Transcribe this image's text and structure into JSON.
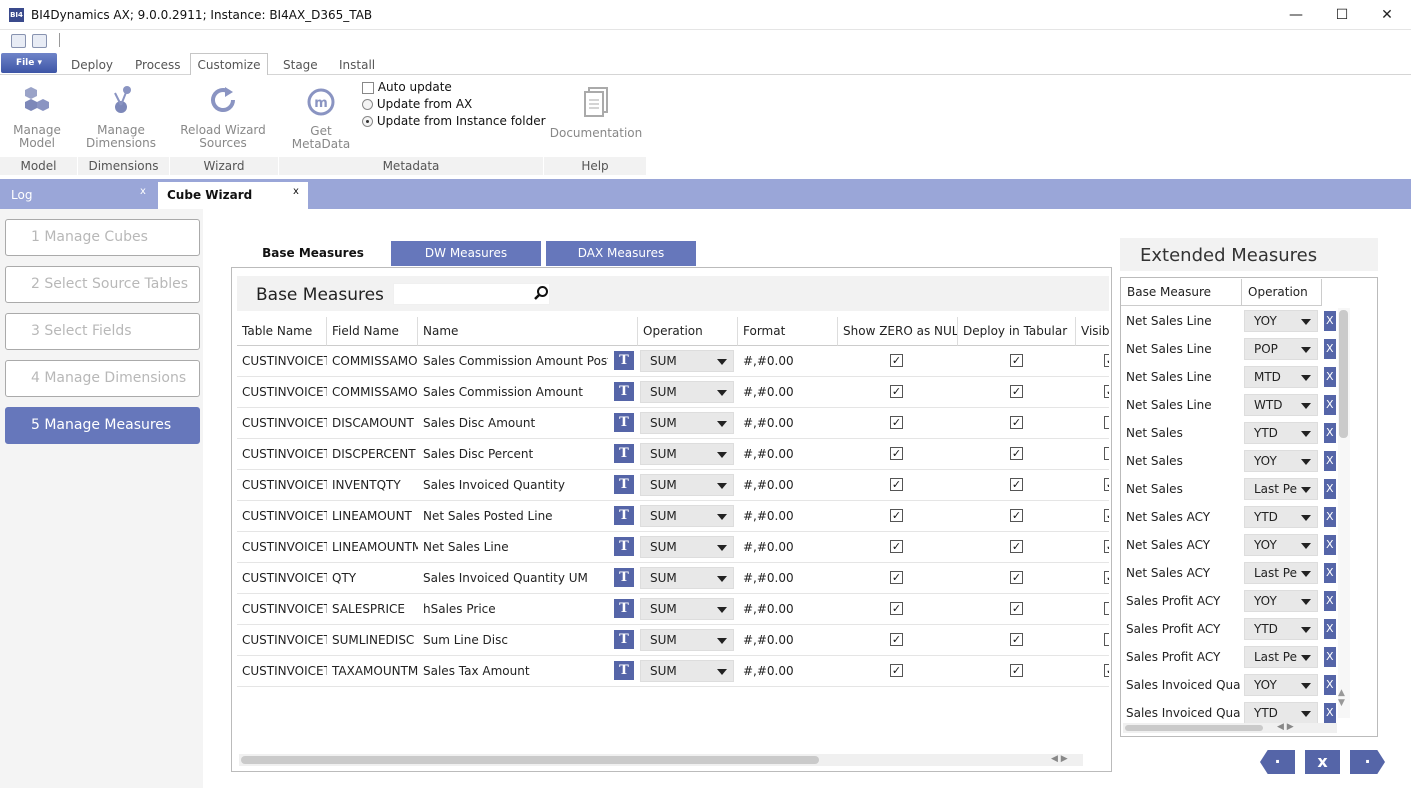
{
  "window": {
    "title": "BI4Dynamics AX; 9.0.0.2911;  Instance: BI4AX_D365_TAB",
    "app_icon_text": "BI4",
    "minimize": "—",
    "maximize": "☐",
    "close": "✕"
  },
  "menu": {
    "file_label": "File ▾",
    "tabs": [
      "Deploy",
      "Process",
      "Customize",
      "Stage",
      "Install"
    ],
    "active_tab": "Customize"
  },
  "ribbon": {
    "manage_model": [
      "Manage",
      "Model"
    ],
    "manage_dimensions": [
      "Manage",
      "Dimensions"
    ],
    "reload_wizard": [
      "Reload Wizard",
      "Sources"
    ],
    "get_metadata": [
      "Get",
      "MetaData"
    ],
    "auto_update": "Auto update",
    "update_from_ax": "Update from AX",
    "update_from_instance": "Update from Instance folder",
    "documentation": "Documentation",
    "groups": [
      "Model",
      "Dimensions",
      "Wizard",
      "Metadata",
      "Help"
    ]
  },
  "doc_tabs": [
    {
      "label": "Log",
      "close": "x"
    },
    {
      "label": "Cube Wizard",
      "close": "x"
    }
  ],
  "steps": [
    "1   Manage Cubes",
    "2   Select Source Tables",
    "3   Select Fields",
    "4   Manage Dimensions",
    "5   Manage Measures"
  ],
  "active_step": 4,
  "measure_tabs": [
    "Base Measures",
    "DW Measures",
    "DAX Measures"
  ],
  "base": {
    "title": "Base Measures",
    "search_placeholder": "",
    "columns": [
      "Table Name",
      "Field Name",
      "Name",
      "Operation",
      "Format",
      "Show ZERO as NULL",
      "Deploy in Tabular",
      "Visible"
    ],
    "rows": [
      {
        "table": "CUSTINVOICET",
        "field": "COMMISSAMO",
        "name": "Sales Commission Amount Posted",
        "op": "SUM",
        "format": "#,#0.00",
        "zero_null": true,
        "deploy": true,
        "visible": true
      },
      {
        "table": "CUSTINVOICET",
        "field": "COMMISSAMO",
        "name": "Sales Commission Amount",
        "op": "SUM",
        "format": "#,#0.00",
        "zero_null": true,
        "deploy": true,
        "visible": true
      },
      {
        "table": "CUSTINVOICET",
        "field": "DISCAMOUNT",
        "name": "Sales Disc Amount",
        "op": "SUM",
        "format": "#,#0.00",
        "zero_null": true,
        "deploy": true,
        "visible": false
      },
      {
        "table": "CUSTINVOICET",
        "field": "DISCPERCENT",
        "name": "Sales Disc Percent",
        "op": "SUM",
        "format": "#,#0.00",
        "zero_null": true,
        "deploy": true,
        "visible": false
      },
      {
        "table": "CUSTINVOICET",
        "field": "INVENTQTY",
        "name": "Sales Invoiced Quantity",
        "op": "SUM",
        "format": "#,#0.00",
        "zero_null": true,
        "deploy": true,
        "visible": true
      },
      {
        "table": "CUSTINVOICET",
        "field": "LINEAMOUNT",
        "name": "Net Sales Posted Line",
        "op": "SUM",
        "format": "#,#0.00",
        "zero_null": true,
        "deploy": true,
        "visible": true
      },
      {
        "table": "CUSTINVOICET",
        "field": "LINEAMOUNTM",
        "name": "Net Sales Line",
        "op": "SUM",
        "format": "#,#0.00",
        "zero_null": true,
        "deploy": true,
        "visible": true
      },
      {
        "table": "CUSTINVOICET",
        "field": "QTY",
        "name": "Sales Invoiced Quantity UM",
        "op": "SUM",
        "format": "#,#0.00",
        "zero_null": true,
        "deploy": true,
        "visible": true
      },
      {
        "table": "CUSTINVOICET",
        "field": "SALESPRICE",
        "name": "hSales Price",
        "op": "SUM",
        "format": "#,#0.00",
        "zero_null": true,
        "deploy": true,
        "visible": false
      },
      {
        "table": "CUSTINVOICET",
        "field": "SUMLINEDISC",
        "name": "Sum Line Disc",
        "op": "SUM",
        "format": "#,#0.00",
        "zero_null": true,
        "deploy": true,
        "visible": false
      },
      {
        "table": "CUSTINVOICET",
        "field": "TAXAMOUNTM",
        "name": "Sales Tax Amount",
        "op": "SUM",
        "format": "#,#0.00",
        "zero_null": true,
        "deploy": true,
        "visible": true
      }
    ]
  },
  "extended": {
    "title": "Extended Measures",
    "columns": [
      "Base Measure",
      "Operation"
    ],
    "rows": [
      {
        "base": "Net Sales Line",
        "op": "YOY"
      },
      {
        "base": "Net Sales Line",
        "op": "POP"
      },
      {
        "base": "Net Sales Line",
        "op": "MTD"
      },
      {
        "base": "Net Sales Line",
        "op": "WTD"
      },
      {
        "base": "Net Sales",
        "op": "YTD"
      },
      {
        "base": "Net Sales",
        "op": "YOY"
      },
      {
        "base": "Net Sales",
        "op": "Last Pe"
      },
      {
        "base": "Net Sales ACY",
        "op": "YTD"
      },
      {
        "base": "Net Sales ACY",
        "op": "YOY"
      },
      {
        "base": "Net Sales ACY",
        "op": "Last Pe"
      },
      {
        "base": "Sales Profit ACY",
        "op": "YOY"
      },
      {
        "base": "Sales Profit ACY",
        "op": "YTD"
      },
      {
        "base": "Sales Profit ACY",
        "op": "Last Pe"
      },
      {
        "base": "Sales Invoiced Quant",
        "op": "YOY"
      },
      {
        "base": "Sales Invoiced Quant",
        "op": "YTD"
      }
    ]
  },
  "nav": {
    "prev": "·",
    "cancel": "x",
    "next": "·"
  },
  "colors": {
    "accent": "#5565a8",
    "step_active": "#6677bb",
    "doctab_bar": "#9aa6d8"
  },
  "icons": {
    "tbtn": "T",
    "check": "✓",
    "remove": "X"
  }
}
